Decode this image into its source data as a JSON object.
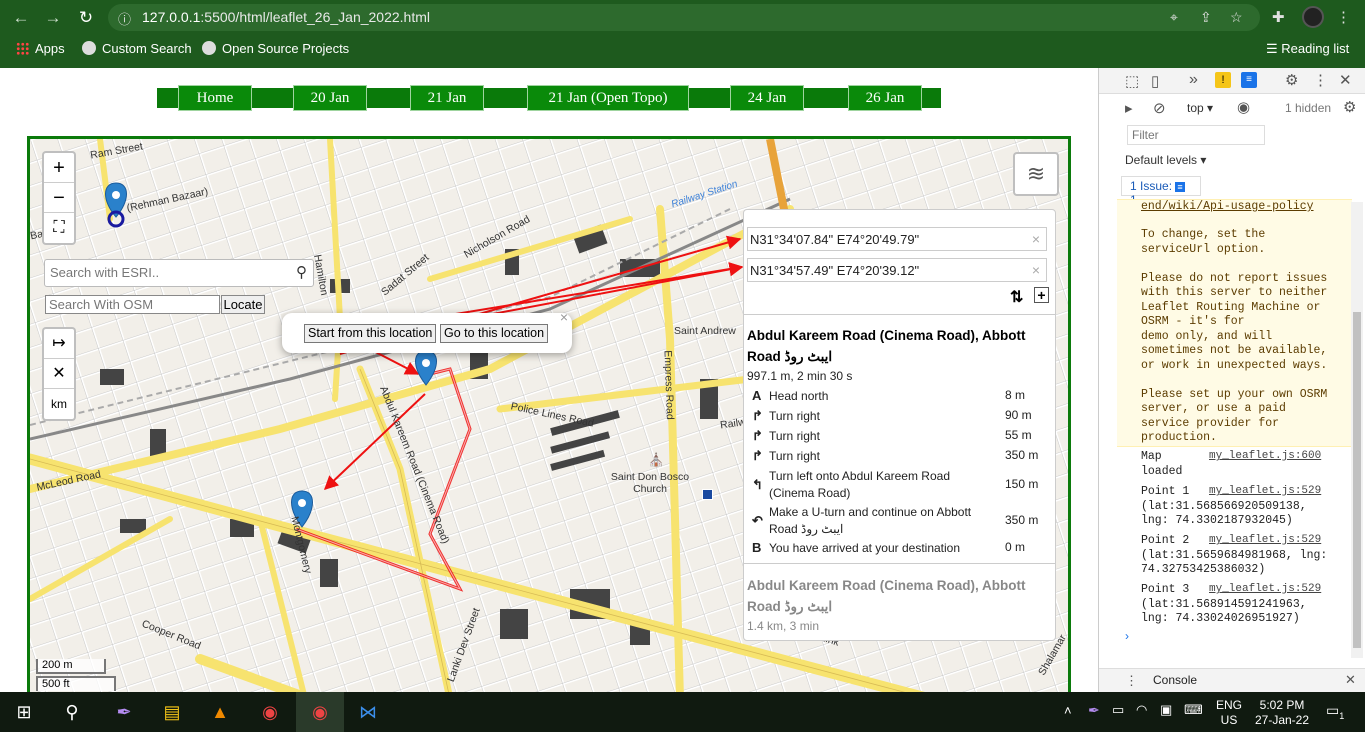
{
  "browser": {
    "url_host": "127.0.0.1",
    "url_rest": ":5500/html/leaflet_26_Jan_2022.html",
    "bookmarks": [
      "Apps",
      "Custom Search",
      "Open Source Projects"
    ],
    "reading_list": "Reading list"
  },
  "nav": [
    "Home",
    "20 Jan",
    "21 Jan",
    "21 Jan (Open Topo)",
    "24 Jan",
    "26 Jan"
  ],
  "map": {
    "esri_placeholder": "Search with ESRI..",
    "osm_placeholder": "Search With OSM",
    "locate_label": "Locate",
    "popup_start": "Start from this location",
    "popup_go": "Go to this location",
    "km_label": "km",
    "scale_m": "200 m",
    "scale_ft": "500 ft",
    "labels": {
      "railway_station": "Railway Station",
      "nicholson": "Nicholson Road",
      "sadat": "Sadat Street",
      "empress": "Empress Road",
      "police_lines": "Police Lines Road",
      "mcleod": "McLeod Road",
      "cooper": "Cooper Road",
      "saint_andrew": "Saint Andrew",
      "saint_don_bosco": "Saint Don Bosco Church",
      "abdul_kareem": "Abdul Kareem Road (Cinema Road)",
      "montgomery": "Montgomery",
      "lanki_dev": "Lanki Dev Street",
      "bazaar": "Bazaar",
      "rehman": "(Rehman Bazaar)",
      "ram": "Ram Street",
      "railway": "Railway",
      "link": "Link",
      "shalamar": "Shalamar",
      "hamilton": "Hamilton"
    },
    "routing": {
      "from": "N31°34'07.84\" E74°20'49.79\"",
      "to": "N31°34'57.49\" E74°20'39.12\"",
      "route1_title": "Abdul Kareem Road (Cinema Road), Abbott Road ایبٹ روڈ",
      "route1_summary": "997.1 m, 2 min 30 s",
      "instructions": [
        {
          "icon": "A",
          "text": "Head north",
          "dist": "8 m"
        },
        {
          "icon": "↱",
          "text": "Turn right",
          "dist": "90 m"
        },
        {
          "icon": "↱",
          "text": "Turn right",
          "dist": "55 m"
        },
        {
          "icon": "↱",
          "text": "Turn right",
          "dist": "350 m"
        },
        {
          "icon": "↰",
          "text": "Turn left onto Abdul Kareem Road (Cinema Road)",
          "dist": "150 m"
        },
        {
          "icon": "↶",
          "text": "Make a U-turn and continue on Abbott Road ایبٹ روڈ",
          "dist": "350 m"
        },
        {
          "icon": "B",
          "text": "You have arrived at your destination",
          "dist": "0 m"
        }
      ],
      "route2_title": "Abdul Kareem Road (Cinema Road), Abbott Road ایبٹ روڈ",
      "route2_summary": "1.4 km, 3 min"
    }
  },
  "devtools": {
    "context": "top",
    "hidden": "1 hidden",
    "filter_placeholder": "Filter",
    "levels": "Default levels",
    "issues": "1 Issue:",
    "issues_count": "1",
    "link_line": "end/wiki/Api-usage-policy",
    "warn_text": "To change, set the\nserviceUrl option.\n\nPlease do not report issues\nwith this server to neither\nLeaflet Routing Machine or\nOSRM - it's for\ndemo only, and will\nsometimes not be available,\nor work in unexpected ways.\n\nPlease set up your own OSRM\nserver, or use a paid\nservice provider for\nproduction.",
    "logs": [
      {
        "text": "Map\nloaded",
        "src": "my_leaflet.js:600"
      },
      {
        "text": "Point 1\n(lat:31.568566920509138,\nlng: 74.3302187932045)",
        "src": "my_leaflet.js:529"
      },
      {
        "text": "Point 2\n(lat:31.5659684981968, lng:\n74.32753425386032)",
        "src": "my_leaflet.js:529"
      },
      {
        "text": "Point 3\n(lat:31.568914591241963,\nlng: 74.33024026951927)",
        "src": "my_leaflet.js:529"
      }
    ],
    "console_tab": "Console"
  },
  "taskbar": {
    "lang": "ENG",
    "region": "US",
    "time": "5:02 PM",
    "date": "27-Jan-22",
    "notif": "1"
  }
}
